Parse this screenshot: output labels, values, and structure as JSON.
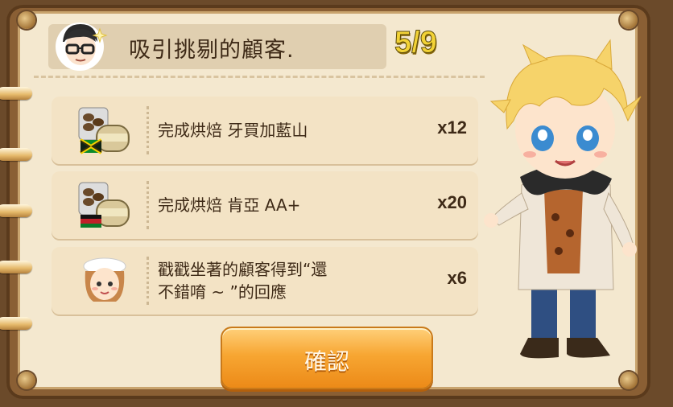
{
  "header": {
    "title": "吸引挑剔的顧客.",
    "progress": "5/9"
  },
  "tasks": [
    {
      "text_line1": "完成烘焙 牙買加藍山",
      "text_line2": "",
      "quantity": "x12",
      "icon": "jamaica-coffee-bag-icon"
    },
    {
      "text_line1": "完成烘焙 肯亞 AA+",
      "text_line2": "",
      "quantity": "x20",
      "icon": "kenya-coffee-bag-icon"
    },
    {
      "text_line1": "戳戳坐著的顧客得到“還",
      "text_line2": "不錯唷 ~ ”的回應",
      "quantity": "x6",
      "icon": "customer-face-icon"
    }
  ],
  "confirm_label": "確認",
  "colors": {
    "accent": "#f2d236",
    "button": "#f7a632",
    "paper": "#f4e8cf"
  }
}
